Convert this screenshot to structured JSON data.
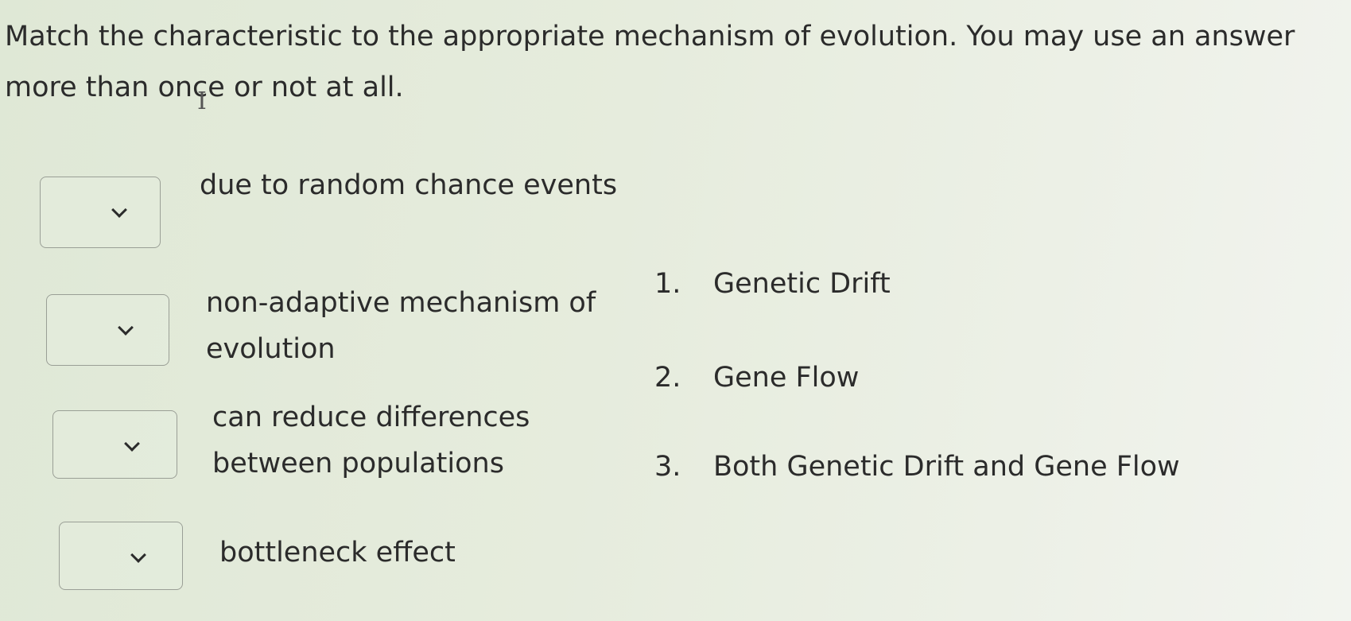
{
  "question": {
    "text": "Match the characteristic to the appropriate mechanism of evolution.  You may use an answer more than once or not at all."
  },
  "prompts": [
    {
      "text": "due to random chance events",
      "selected": ""
    },
    {
      "text": "non-adaptive mechanism of evolution",
      "selected": ""
    },
    {
      "text": "can reduce differences between populations",
      "selected": ""
    },
    {
      "text": "bottleneck effect",
      "selected": ""
    }
  ],
  "answers": [
    {
      "number": "1.",
      "label": "Genetic Drift"
    },
    {
      "number": "2.",
      "label": "Gene Flow"
    },
    {
      "number": "3.",
      "label": "Both Genetic Drift and Gene Flow"
    }
  ],
  "icons": {
    "dropdown": "chevron-down-icon",
    "cursor": "text-cursor-icon"
  }
}
